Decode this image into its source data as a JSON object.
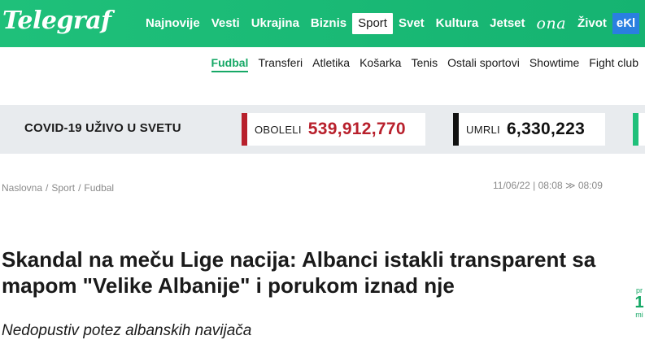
{
  "header": {
    "logo": "Telegraf",
    "nav": [
      {
        "label": "Najnovije"
      },
      {
        "label": "Vesti"
      },
      {
        "label": "Ukrajina"
      },
      {
        "label": "Biznis"
      },
      {
        "label": "Sport",
        "active": true
      },
      {
        "label": "Svet"
      },
      {
        "label": "Kultura"
      },
      {
        "label": "Jetset"
      },
      {
        "label": "ona"
      },
      {
        "label": "Život"
      },
      {
        "label": "eKl"
      }
    ]
  },
  "subnav": [
    {
      "label": "Fudbal",
      "active": true
    },
    {
      "label": "Transferi"
    },
    {
      "label": "Atletika"
    },
    {
      "label": "Košarka"
    },
    {
      "label": "Tenis"
    },
    {
      "label": "Ostali sportovi"
    },
    {
      "label": "Showtime"
    },
    {
      "label": "Fight club"
    }
  ],
  "covid": {
    "title": "COVID-19 UŽIVO U SVETU",
    "infected_label": "OBOLELI",
    "infected_value": "539,912,770",
    "deaths_label": "UMRLI",
    "deaths_value": "6,330,223",
    "colors": {
      "infected": "#b8202c",
      "deaths": "#111111",
      "recovered": "#1fc07a"
    }
  },
  "breadcrumb": [
    "Naslovna",
    "Sport",
    "Fudbal"
  ],
  "dates": "11/06/22 | 08:08 ≫ 08:09",
  "article": {
    "headline": "Skandal na meču Lige nacija: Albanci istakli transparent sa mapom \"Velike Albanije\" i porukom iznad nje",
    "lead": "Nedopustiv potez albanskih navijača"
  },
  "side_widget": {
    "top": "pr",
    "number": "1",
    "bottom": "mi"
  },
  "brand_color": "#1fc07a"
}
